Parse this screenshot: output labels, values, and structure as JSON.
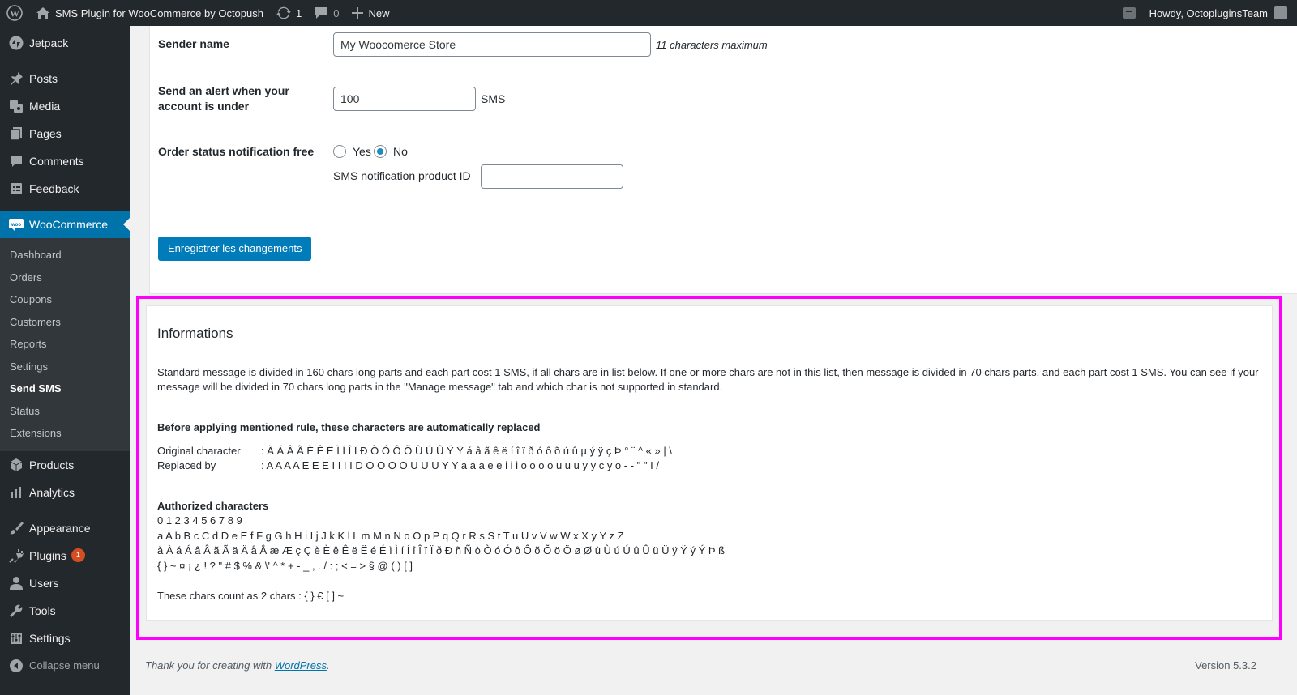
{
  "adminbar": {
    "site_name": "SMS Plugin for WooCommerce by Octopush",
    "updates_count": "1",
    "comments_count": "0",
    "new_label": "New",
    "howdy": "Howdy, OctopluginsTeam"
  },
  "sidebar": {
    "items_top": [
      {
        "label": "Jetpack",
        "icon": "jetpack-icon"
      },
      {
        "label": "Posts",
        "icon": "pin-icon"
      },
      {
        "label": "Media",
        "icon": "media-icon"
      },
      {
        "label": "Pages",
        "icon": "pages-icon"
      },
      {
        "label": "Comments",
        "icon": "comment-icon"
      },
      {
        "label": "Feedback",
        "icon": "feedback-icon"
      }
    ],
    "woocommerce_label": "WooCommerce",
    "submenu": [
      "Dashboard",
      "Orders",
      "Coupons",
      "Customers",
      "Reports",
      "Settings",
      "Send SMS",
      "Status",
      "Extensions"
    ],
    "items_bottom": [
      {
        "label": "Products",
        "icon": "box-icon"
      },
      {
        "label": "Analytics",
        "icon": "chart-icon"
      },
      {
        "label": "Appearance",
        "icon": "brush-icon"
      },
      {
        "label": "Plugins",
        "icon": "plug-icon",
        "badge": "1"
      },
      {
        "label": "Users",
        "icon": "user-icon"
      },
      {
        "label": "Tools",
        "icon": "wrench-icon"
      },
      {
        "label": "Settings",
        "icon": "sliders-icon"
      }
    ],
    "collapse_label": "Collapse menu"
  },
  "settings": {
    "sender_name_label": "Sender name",
    "sender_name_value": "My Woocomerce Store",
    "sender_name_hint": "11 characters maximum",
    "alert_label_line1": "Send an alert when your",
    "alert_label_line2": "account is under",
    "alert_value": "100",
    "alert_unit": "SMS",
    "order_status_label": "Order status notification free",
    "radio_yes": "Yes",
    "radio_no": "No",
    "selected": "No",
    "product_id_label": "SMS notification product ID",
    "product_id_value": "",
    "save_label": "Enregistrer les changements"
  },
  "info": {
    "title": "Informations",
    "description": "Standard message is divided in 160 chars long parts and each part cost 1 SMS, if all chars are in list below. If one or more chars are not in this list, then message is divided in 70 chars parts, and each part cost 1 SMS. You can see if your message will be divided in 70 chars long parts in the \"Manage message\" tab and which char is not supported in standard.",
    "replace_heading": "Before applying mentioned rule, these characters are automatically replaced",
    "original_label": "Original character",
    "original_chars": ": À Á Â Ã È Ê Ë Ì Í Î Ï Ð Ò Ó Ô Õ Ù Ú Û Ý Ÿ á â ã ê ë í î ï ð ó ô õ ú û µ ý ÿ ç Þ ° ¨ ^ « » | \\",
    "replaced_label": "Replaced by",
    "replaced_chars": ": A A A A E E E I I I I D O O O O U U U Y Y a a a e e i i i o o o o u u u y y c y o - - \" \" I /",
    "authorized_heading": "Authorized characters",
    "authorized_lines": [
      "0 1 2 3 4 5 6 7 8 9",
      "a A b B c C d D e E f F g G h H i I j J k K l L m M n N o O p P q Q r R s S t T u U v V w W x X y Y z Z",
      "à À á Á â Â ã Ã ä Ä å Å æ Æ ç Ç è È ê Ê ë Ë é É ì Ì í Í î Î ï Ï ð Ð ñ Ñ ò Ò ó Ó ô Ô õ Õ ö Ö ø Ø ù Ù ú Ú û Û ü Ü ÿ Ÿ ý Ý Þ ß",
      "{ } ~ ¤ ¡ ¿ ! ? \" # $ % & \\' ^ * + - _ , . / : ; < = > § @ ( ) [ ]"
    ],
    "double_count": "These chars count as 2 chars : { } € [ ] ~"
  },
  "footer": {
    "thanks_prefix": "Thank you for creating with ",
    "thanks_link": "WordPress",
    "thanks_suffix": ".",
    "version": "Version 5.3.2"
  },
  "colors": {
    "sidebar_bg": "#23282d",
    "accent": "#0073aa",
    "highlight_outline": "#ff00ff"
  }
}
